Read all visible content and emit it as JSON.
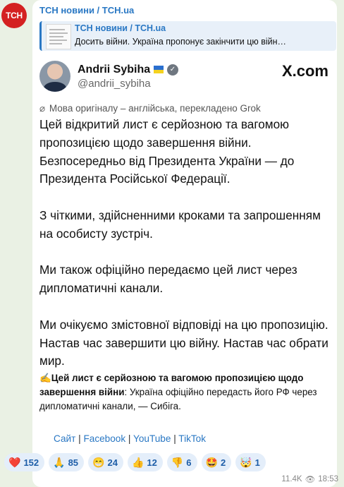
{
  "channel": {
    "avatar_text": "ТСН",
    "name": "ТСН новини / TCH.ua"
  },
  "forward": {
    "title": "ТСН новини / TCH.ua",
    "text": "Досить війни. Україна пропонує закінчити цю війн…"
  },
  "tweet": {
    "name": "Andrii Sybiha",
    "handle": "@andrii_sybiha",
    "platform": "X.com",
    "translation_note": "Мова оригіналу – англійська, перекладено Grok",
    "paragraphs": [
      "Цей відкритий лист є серйозною та вагомою пропозицією щодо завершення війни. Безпосередньо від Президента України — до Президента Російської Федерації.",
      "З чіткими, здійсненними кроками та запрошенням на особисту зустріч.",
      "Ми також офіційно передаємо цей лист через дипломатичні канали.",
      "Ми очікуємо змістовної відповіді на цю пропозицію. Настав час завершити цю війну. Настав час обрати мир."
    ]
  },
  "caption": {
    "emoji": "✍️",
    "bold": "Цей лист є серйозною та вагомою пропозицією щодо завершення війни",
    "rest": ": Україна офіційно передасть його РФ через дипломатичні канали, — Сибіга."
  },
  "links": [
    "Сайт",
    "Facebook",
    "YouTube",
    "TikTok"
  ],
  "reactions": [
    {
      "icon": "heart-icon",
      "emoji": "❤️",
      "count": "152"
    },
    {
      "icon": "pray-icon",
      "emoji": "🙏",
      "count": "85"
    },
    {
      "icon": "grin-icon",
      "emoji": "😁",
      "count": "24"
    },
    {
      "icon": "thumbs-up-icon",
      "emoji": "👍",
      "count": "12"
    },
    {
      "icon": "thumbs-down-icon",
      "emoji": "👎",
      "count": "6"
    },
    {
      "icon": "star-struck-icon",
      "emoji": "🤩",
      "count": "2"
    },
    {
      "icon": "exploding-head-icon",
      "emoji": "🤯",
      "count": "1"
    }
  ],
  "meta": {
    "views": "11.4K",
    "time": "18:53"
  },
  "colors": {
    "link": "#2a78c4",
    "accent_red": "#d42121",
    "background": "#eaf1e4"
  }
}
